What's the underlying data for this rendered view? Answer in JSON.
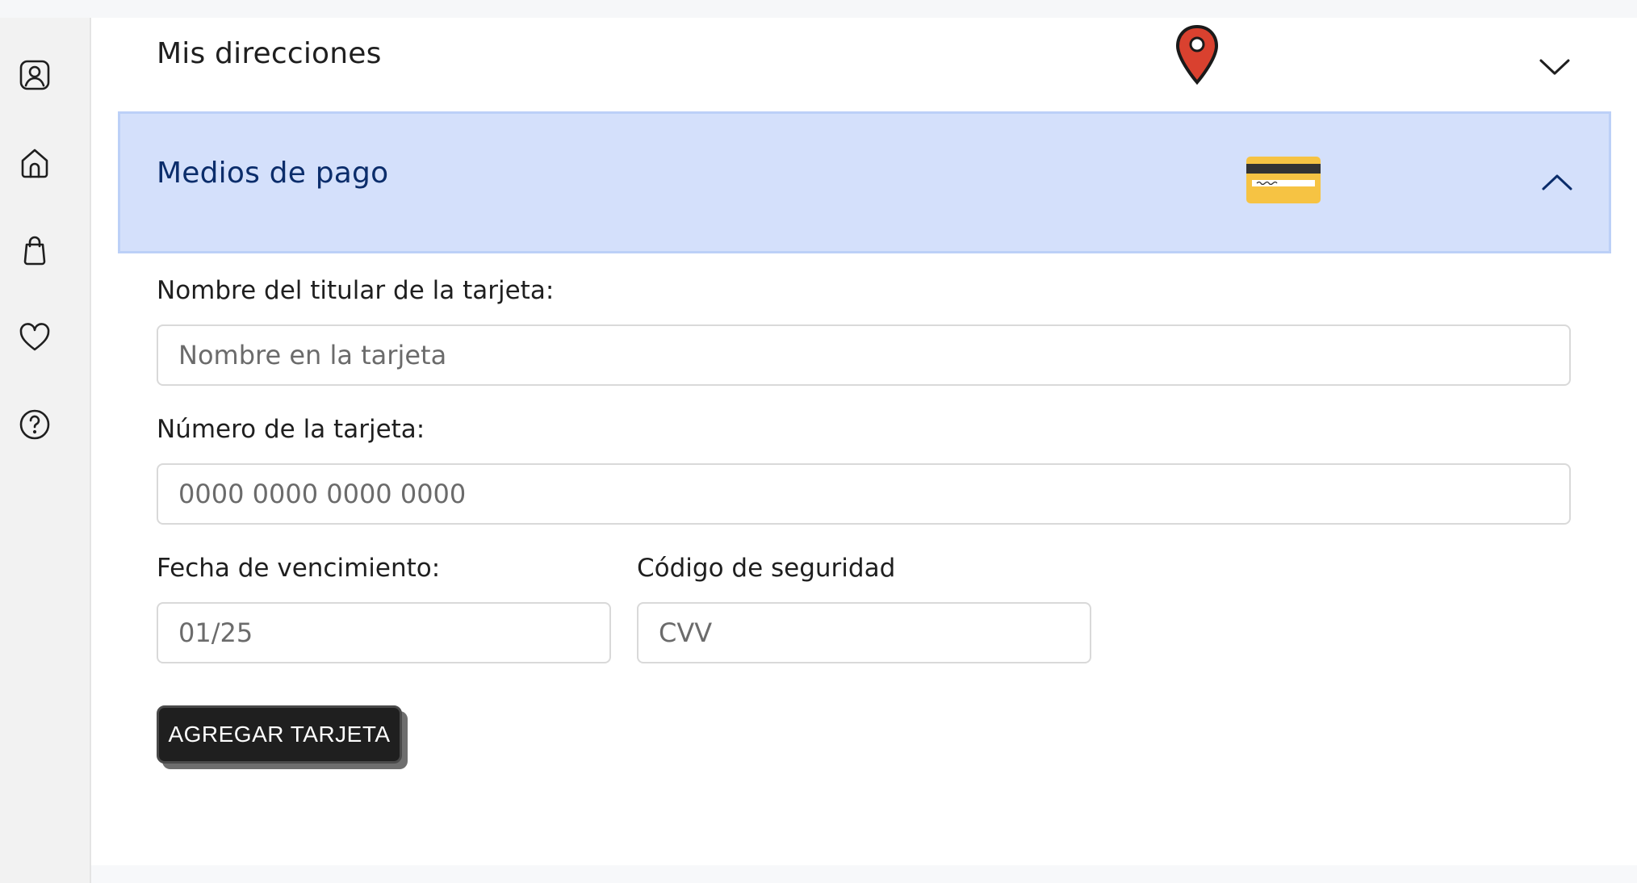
{
  "sidebar": {
    "items": [
      {
        "icon": "user-profile-icon"
      },
      {
        "icon": "home-icon"
      },
      {
        "icon": "shopping-bag-icon"
      },
      {
        "icon": "heart-icon"
      },
      {
        "icon": "help-icon"
      }
    ]
  },
  "sections": {
    "addresses": {
      "title": "Mis direcciones",
      "icon": "map-pin-icon",
      "expanded": false
    },
    "payment": {
      "title": "Medios de pago",
      "icon": "credit-card-icon",
      "expanded": true
    }
  },
  "form": {
    "holder_label": "Nombre del titular de la tarjeta:",
    "holder_placeholder": "Nombre en la tarjeta",
    "number_label": "Número de la tarjeta:",
    "number_placeholder": "0000 0000 0000 0000",
    "expiry_label": "Fecha de vencimiento:",
    "expiry_placeholder": "01/25",
    "cvv_label": "Código de seguridad",
    "cvv_placeholder": "CVV",
    "submit_label": "AGREGAR TARJETA"
  },
  "colors": {
    "active_section_bg": "#d4e0fb",
    "active_section_text": "#0b2d6b",
    "button_bg": "#1f1f1f",
    "pin_red": "#d9412f",
    "card_yellow": "#f6c343"
  }
}
